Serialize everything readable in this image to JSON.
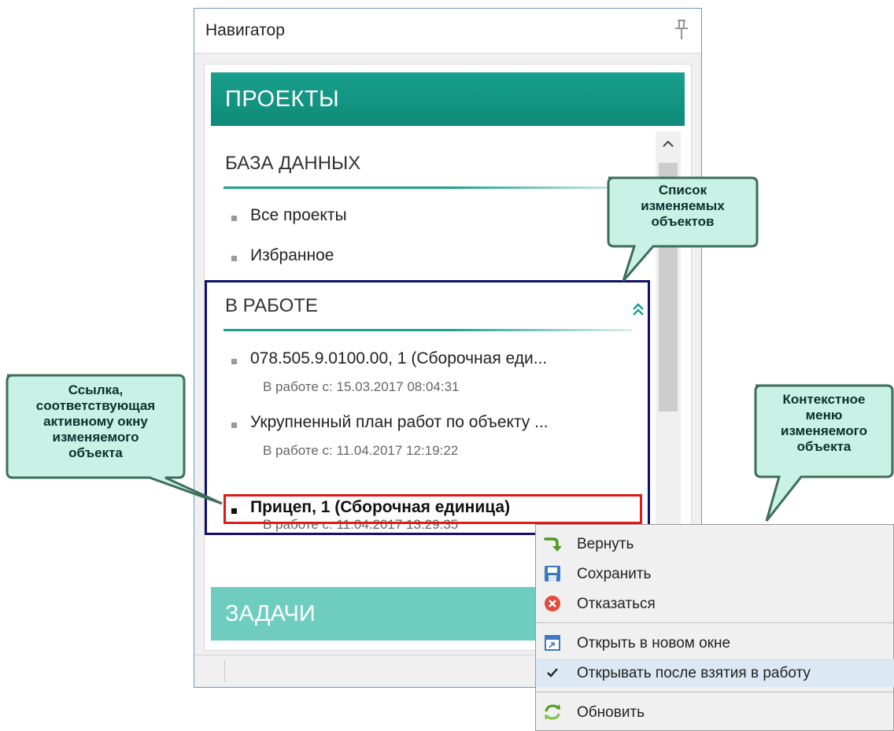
{
  "navigator": {
    "title": "Навигатор",
    "projects_header": "ПРОЕКТЫ",
    "database": {
      "title": "БАЗА ДАННЫХ",
      "items": [
        "Все проекты",
        "Избранное"
      ]
    },
    "in_work": {
      "title": "В РАБОТЕ",
      "items": [
        {
          "label": "078.505.9.0100.00, 1 (Сборочная еди...",
          "since": "В работе с: 15.03.2017 08:04:31"
        },
        {
          "label": "Укрупненный план работ по объекту ...",
          "since": "В работе с: 11.04.2017 12:19:22"
        },
        {
          "label": "Прицеп, 1 (Сборочная единица)",
          "since": "В работе с: 11.04.2017 13:29:35"
        }
      ]
    },
    "tasks_header": "ЗАДАЧИ"
  },
  "callouts": {
    "list": [
      "Список",
      "изменяемых",
      "объектов"
    ],
    "link": [
      "Ссылка,",
      "соответствующая",
      "активному окну",
      "изменяемого",
      "объекта"
    ],
    "menu": [
      "Контекстное",
      "меню",
      "изменяемого",
      "объекта"
    ]
  },
  "context_menu": {
    "items": [
      {
        "label": "Вернуть",
        "icon": "return-arrow-icon"
      },
      {
        "label": "Сохранить",
        "icon": "save-icon"
      },
      {
        "label": "Отказаться",
        "icon": "cancel-icon"
      },
      {
        "label": "Открыть в новом окне",
        "icon": "new-window-icon"
      },
      {
        "label": "Открывать после взятия в работу",
        "icon": "checkmark-icon"
      },
      {
        "label": "Обновить",
        "icon": "refresh-icon"
      }
    ]
  },
  "colors": {
    "accent": "#1aa08e",
    "tasks_header": "#6ecdbf",
    "callout_fill": "#c9f1e5",
    "callout_border": "#3c6e5a",
    "in_work_frame": "#101070",
    "active_frame": "#e01818"
  }
}
